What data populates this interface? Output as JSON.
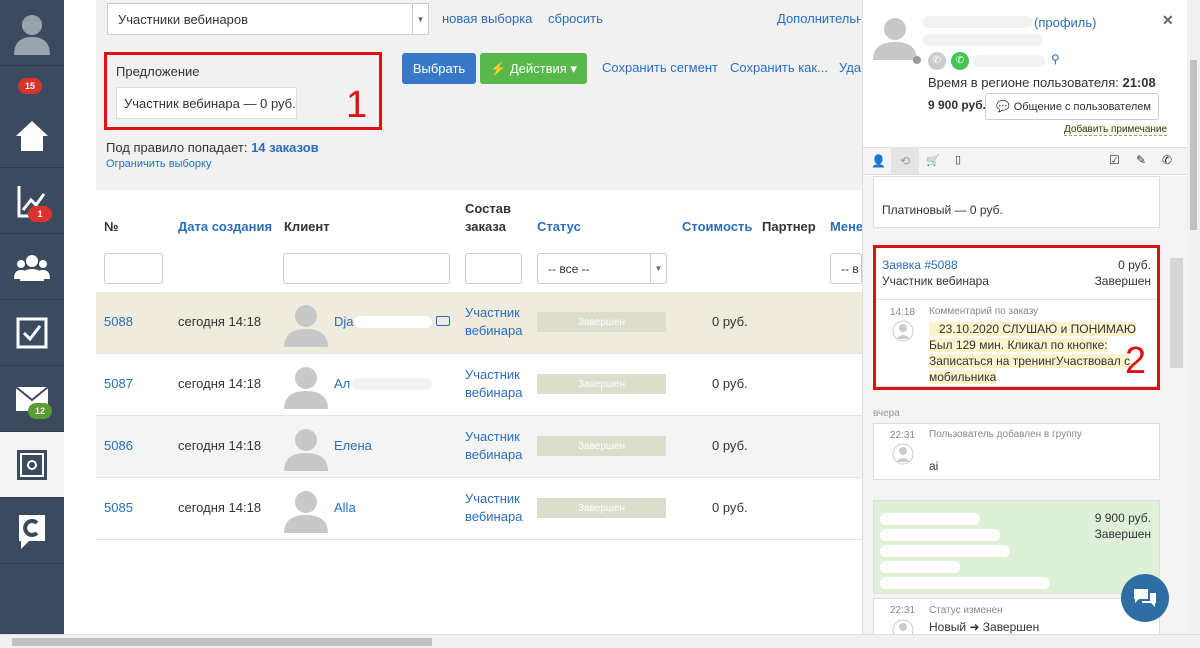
{
  "sidebar": {
    "badges": {
      "b1": "15",
      "b2": "1",
      "b3": "12"
    }
  },
  "toolbar": {
    "segment_select": "Участники вебинаров",
    "new_selection": "новая выборка",
    "reset": "сбросить",
    "additional": "Дополнительн"
  },
  "offer": {
    "label": "Предложение",
    "value": "Участник вебинара — 0 руб.",
    "marker": "1"
  },
  "buttons": {
    "select": "Выбрать",
    "actions": "⚡ Действия ▾",
    "save_segment": "Сохранить сегмент",
    "save_as": "Сохранить как...",
    "delete_partial": "Уда"
  },
  "summary": {
    "prefix": "Под правило попадает:",
    "count": "14 заказов",
    "limit": "Ограничить выборку"
  },
  "table": {
    "headers": {
      "num": "№",
      "created": "Дата создания",
      "client": "Клиент",
      "composition_1": "Состав",
      "composition_2": "заказа",
      "status": "Статус",
      "cost": "Стоимость",
      "partner": "Партнер",
      "manager": "Мене"
    },
    "status_filter": "-- все --",
    "manager_filter": "-- в",
    "rows": [
      {
        "id": "5088",
        "date": "сегодня 14:18",
        "client": "Dja",
        "comp1": "Участник",
        "comp2": "вебинара",
        "status": "Завершен",
        "cost": "0 руб."
      },
      {
        "id": "5087",
        "date": "сегодня 14:18",
        "client": "Ал",
        "comp1": "Участник",
        "comp2": "вебинара",
        "status": "Завершен",
        "cost": "0 руб."
      },
      {
        "id": "5086",
        "date": "сегодня 14:18",
        "client": "Елена",
        "comp1": "Участник",
        "comp2": "вебинара",
        "status": "Завершен",
        "cost": "0 руб."
      },
      {
        "id": "5085",
        "date": "сегодня 14:18",
        "client": "Alla",
        "comp1": "Участник",
        "comp2": "вебинара",
        "status": "Завершен",
        "cost": "0 руб."
      }
    ]
  },
  "panel": {
    "profile_link": "(профиль)",
    "time_label": "Время в регионе пользователя:",
    "time_value": "21:08",
    "amount": "9 900 руб.",
    "chat_button": "Общение с пользователем",
    "add_note": "Добавить примечание",
    "plan": "Платиновый — 0 руб.",
    "order_link": "Заявка #5088",
    "order_amount": "0 руб.",
    "order_product": "Участник вебинара",
    "order_status": "Завершен",
    "comment_time": "14:18",
    "comment_title": "Комментарий по заказу",
    "comment_lines": [
      "23.10.2020 СЛУШАЮ и ПОНИМАЮ",
      "Был 129 мин. Кликал по кнопке:",
      "Записаться на тренингУчаствовал с",
      "мобильника"
    ],
    "marker2": "2",
    "yesterday": "вчера",
    "ev1_time": "22:31",
    "ev1_title": "Пользователь добавлен в группу",
    "ev1_text": "аі",
    "green_amount": "9 900 руб.",
    "green_status": "Завершен",
    "ev2_time": "22:31",
    "ev2_title": "Статус изменен",
    "ev2_text": "Новый ➜ Завершен"
  }
}
